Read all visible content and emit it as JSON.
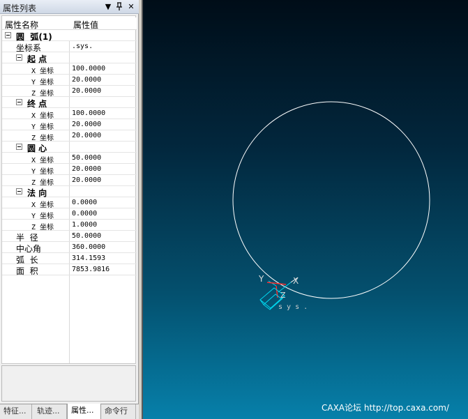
{
  "panel": {
    "title": "属性列表",
    "buttons": {
      "dropdown": "▼",
      "pin": "ᵖ",
      "close": "✕"
    },
    "header": {
      "name_col": "属性名称",
      "value_col": "属性值"
    }
  },
  "props": {
    "arc": {
      "label": "圆  弧(1)"
    },
    "coord_sys": {
      "label": "坐标系",
      "value": ".sys."
    },
    "start": {
      "label": "起 点",
      "x": {
        "label": "X 坐标",
        "value": "100.0000"
      },
      "y": {
        "label": "Y 坐标",
        "value": "20.0000"
      },
      "z": {
        "label": "Z 坐标",
        "value": "20.0000"
      }
    },
    "end": {
      "label": "终 点",
      "x": {
        "label": "X 坐标",
        "value": "100.0000"
      },
      "y": {
        "label": "Y 坐标",
        "value": "20.0000"
      },
      "z": {
        "label": "Z 坐标",
        "value": "20.0000"
      }
    },
    "center": {
      "label": "圆 心",
      "x": {
        "label": "X 坐标",
        "value": "50.0000"
      },
      "y": {
        "label": "Y 坐标",
        "value": "20.0000"
      },
      "z": {
        "label": "Z 坐标",
        "value": "20.0000"
      }
    },
    "normal": {
      "label": "法 向",
      "x": {
        "label": "X 坐标",
        "value": "0.0000"
      },
      "y": {
        "label": "Y 坐标",
        "value": "0.0000"
      },
      "z": {
        "label": "Z 坐标",
        "value": "1.0000"
      }
    },
    "radius": {
      "label": "半  径",
      "value": "50.0000"
    },
    "central_angle": {
      "label": "中心角",
      "value": "360.0000"
    },
    "arc_length": {
      "label": "弧  长",
      "value": "314.1593"
    },
    "area": {
      "label": "面  积",
      "value": "7853.9816"
    }
  },
  "tabs": [
    {
      "label": "特征..."
    },
    {
      "label": "轨迹..."
    },
    {
      "label": "属性..."
    },
    {
      "label": "命令行"
    }
  ],
  "viewport": {
    "axis_x": "X",
    "axis_y": "Y",
    "axis_z": "Z",
    "sys_label": "s y s .",
    "watermark": "CAXA论坛 http://top.caxa.com/",
    "colors": {
      "circle": "#ffffff",
      "triad": "#00d8f0",
      "x_axis": "#ff3030"
    }
  }
}
